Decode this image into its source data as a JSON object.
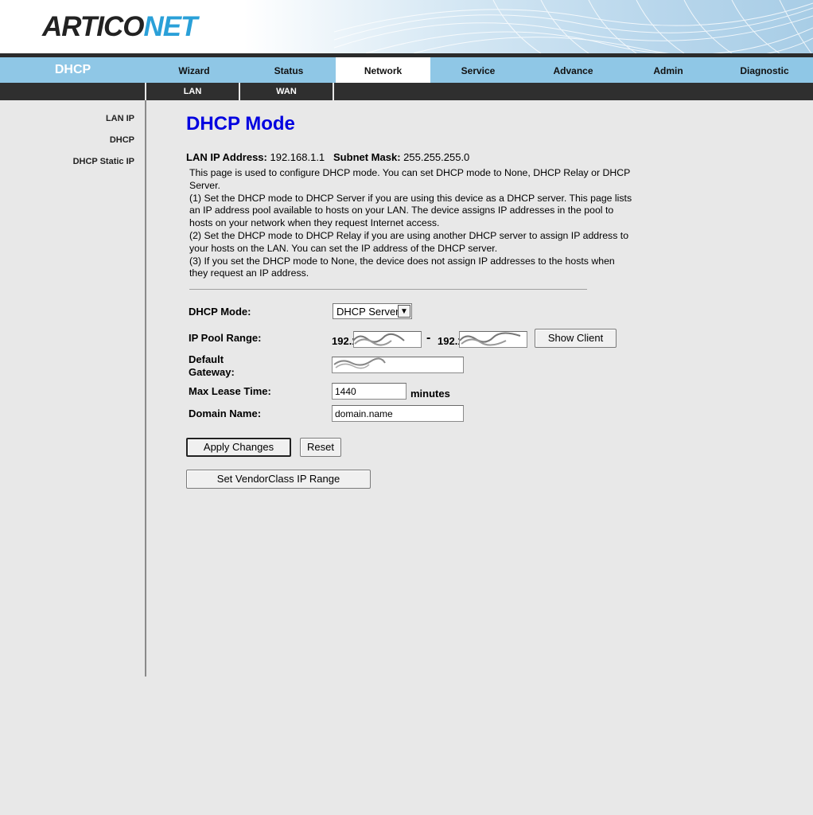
{
  "brand": {
    "logo_part1": "ARTICO",
    "logo_part2": "NET"
  },
  "nav": {
    "section_title": "DHCP",
    "tabs": [
      {
        "label": "Wizard"
      },
      {
        "label": "Status"
      },
      {
        "label": "Network",
        "active": true
      },
      {
        "label": "Service"
      },
      {
        "label": "Advance"
      },
      {
        "label": "Admin"
      },
      {
        "label": "Diagnostic"
      }
    ],
    "subtabs": [
      {
        "label": "LAN"
      },
      {
        "label": "WAN"
      }
    ]
  },
  "sidebar": {
    "items": [
      {
        "label": "LAN IP"
      },
      {
        "label": "DHCP"
      },
      {
        "label": "DHCP Static IP"
      }
    ]
  },
  "page": {
    "title": "DHCP Mode",
    "lan_ip_label": "LAN IP Address:",
    "lan_ip_value": "192.168.1.1",
    "subnet_label": "Subnet Mask:",
    "subnet_value": "255.255.255.0",
    "description": [
      "This page is used to configure DHCP mode. You can set DHCP mode to None, DHCP Relay or DHCP",
      "Server.",
      "(1) Set the DHCP mode to DHCP Server if you are using this device as a DHCP server. This page lists",
      "an IP address pool available to hosts on your LAN. The device assigns IP addresses in the pool to",
      "hosts on your network when they request Internet access.",
      "(2) Set the DHCP mode to DHCP Relay if you are using another DHCP server to assign IP address to",
      "your hosts on the LAN. You can set the IP address of the DHCP server.",
      "(3) If you set the DHCP mode to None, the device does not assign IP addresses to the hosts when",
      "they request an IP address."
    ]
  },
  "form": {
    "dhcp_mode_label": "DHCP Mode:",
    "dhcp_mode_value": "DHCP Server",
    "ip_pool_label": "IP Pool Range:",
    "pool_start_prefix": "192.1",
    "pool_dash": "-",
    "pool_end_prefix": "192.1",
    "show_client_label": "Show Client",
    "gateway_label_1": "Default",
    "gateway_label_2": "Gateway:",
    "max_lease_label": "Max Lease Time:",
    "max_lease_value": "1440",
    "minutes_label": "minutes",
    "domain_label": "Domain Name:",
    "domain_value": "domain.name"
  },
  "buttons": {
    "apply": "Apply Changes",
    "reset": "Reset",
    "vendor_class": "Set VendorClass IP Range"
  },
  "colors": {
    "nav_bg": "#8fc7e6",
    "title_blue": "#0000e0",
    "logo_accent": "#2aa0d8"
  }
}
